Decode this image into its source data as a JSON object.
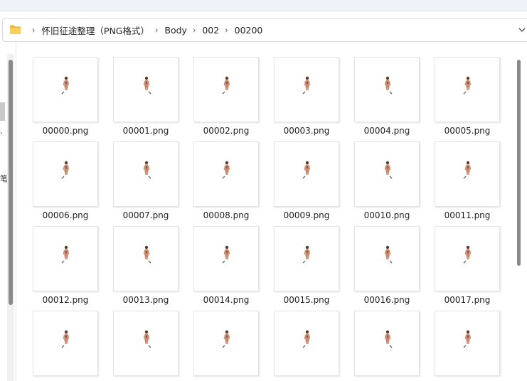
{
  "breadcrumb": {
    "items": [
      "怀旧征途整理（PNG格式）",
      "Body",
      "002",
      "00200"
    ]
  },
  "left_pane": {
    "glyph": "笔"
  },
  "files": [
    {
      "name": "00000.png"
    },
    {
      "name": "00001.png"
    },
    {
      "name": "00002.png"
    },
    {
      "name": "00003.png"
    },
    {
      "name": "00004.png"
    },
    {
      "name": "00005.png"
    },
    {
      "name": "00006.png"
    },
    {
      "name": "00007.png"
    },
    {
      "name": "00008.png"
    },
    {
      "name": "00009.png"
    },
    {
      "name": "00010.png"
    },
    {
      "name": "00011.png"
    },
    {
      "name": "00012.png"
    },
    {
      "name": "00013.png"
    },
    {
      "name": "00014.png"
    },
    {
      "name": "00015.png"
    },
    {
      "name": "00016.png"
    },
    {
      "name": "00017.png"
    },
    {
      "name": ""
    },
    {
      "name": ""
    },
    {
      "name": ""
    },
    {
      "name": ""
    },
    {
      "name": ""
    },
    {
      "name": ""
    }
  ],
  "icons": {
    "folder": "folder-icon",
    "chevron": "chevron-right-icon",
    "dropdown": "chevron-down-icon"
  },
  "colors": {
    "folder_yellow": "#f4c44e",
    "figure_skin": "#c9876a",
    "figure_dark": "#5a3a2e"
  }
}
